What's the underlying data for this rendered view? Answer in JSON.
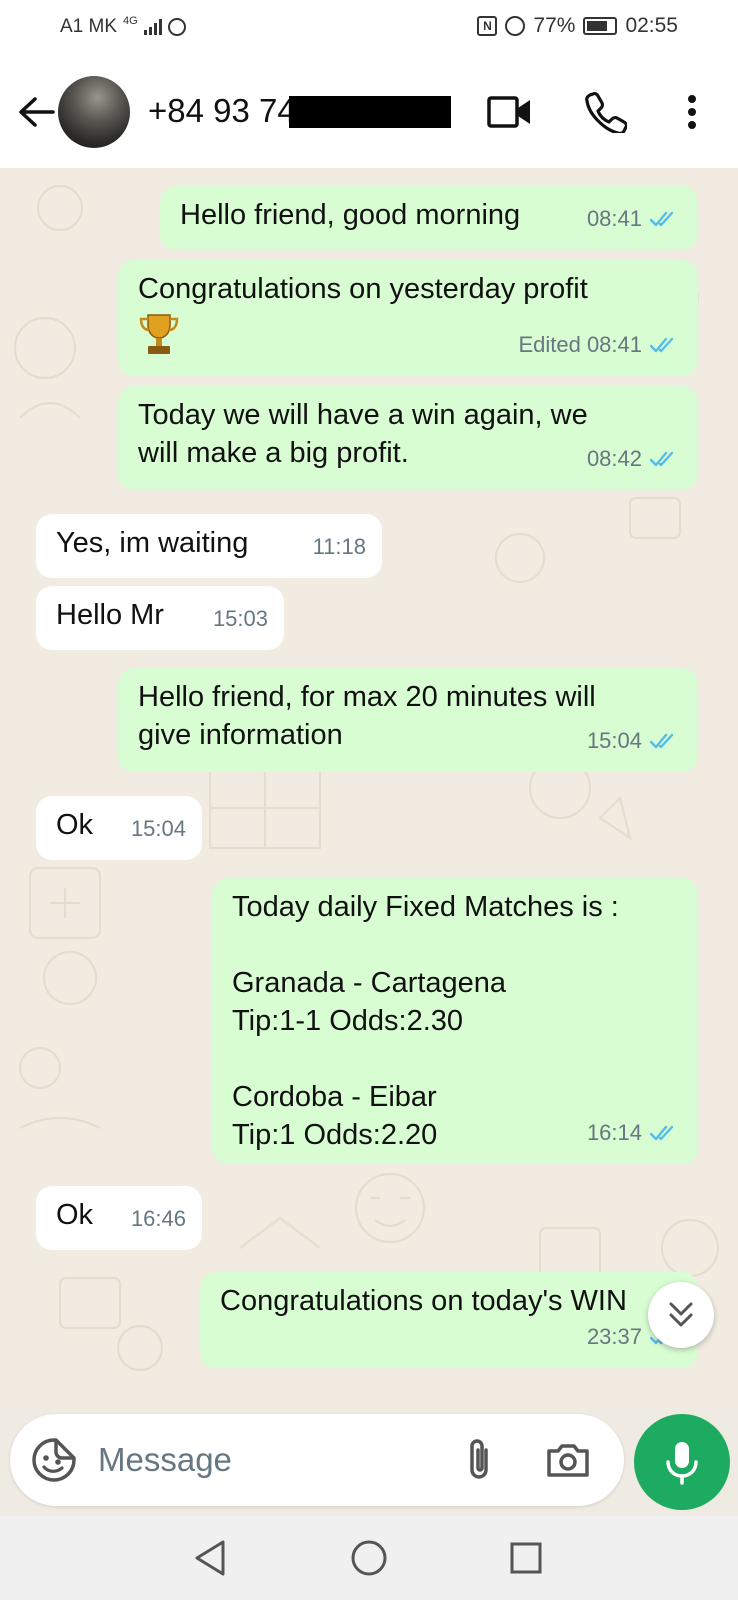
{
  "status_bar": {
    "carrier": "A1 MK",
    "network": "4G",
    "battery": "77%",
    "time": "02:55"
  },
  "header": {
    "contact": "+84 93 74"
  },
  "messages": [
    {
      "dir": "out",
      "text": "Hello friend, good morning",
      "time": "08:41",
      "status": "read"
    },
    {
      "dir": "out",
      "text": "Congratulations on yesterday profit",
      "emoji": "trophy-icon",
      "time": "Edited 08:41",
      "status": "read"
    },
    {
      "dir": "out",
      "text": "Today we will have a win again, we\nwill make a big profit.",
      "time": "08:42",
      "status": "read"
    },
    {
      "dir": "in",
      "text": "Yes, im waiting",
      "time": "11:18"
    },
    {
      "dir": "in",
      "text": "Hello Mr",
      "time": "15:03"
    },
    {
      "dir": "out",
      "text": "Hello friend, for max 20 minutes will\ngive information",
      "time": "15:04",
      "status": "read"
    },
    {
      "dir": "in",
      "text": "Ok",
      "time": "15:04"
    },
    {
      "dir": "out",
      "text": "Today daily Fixed Matches is :\n\nGranada - Cartagena\nTip:1-1  Odds:2.30\n\nCordoba - Eibar\nTip:1  Odds:2.20",
      "time": "16:14",
      "status": "read"
    },
    {
      "dir": "in",
      "text": "Ok",
      "time": "16:46"
    },
    {
      "dir": "out",
      "text": "Congratulations on today's WIN",
      "time": "23:37",
      "status": "read"
    }
  ],
  "composer": {
    "placeholder": "Message"
  },
  "colors": {
    "outgoing_bubble": "#d9fdd3",
    "incoming_bubble": "#ffffff",
    "read_tick": "#53bdeb",
    "accent_green": "#1daa61",
    "wallpaper": "#efeae2"
  }
}
